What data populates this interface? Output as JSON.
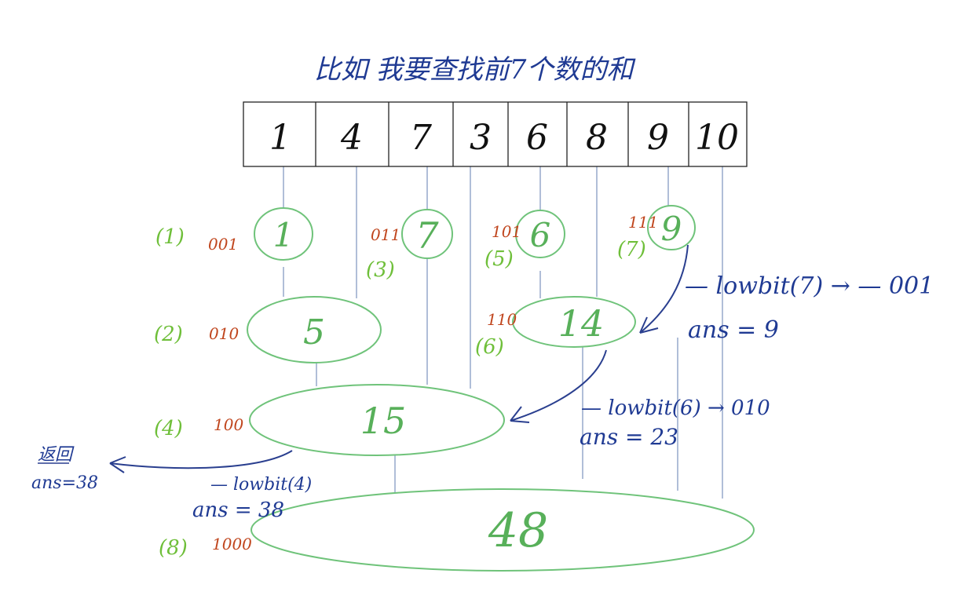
{
  "title": "比如 我要查找前7个数的和",
  "array": [
    "1",
    "4",
    "7",
    "3",
    "6",
    "8",
    "9",
    "10"
  ],
  "nodes": [
    {
      "value": "1",
      "index": "(1)",
      "binary": "001"
    },
    {
      "value": "5",
      "index": "(2)",
      "binary": "010"
    },
    {
      "value": "7",
      "index": "(3)",
      "binary": "011"
    },
    {
      "value": "15",
      "index": "(4)",
      "binary": "100"
    },
    {
      "value": "6",
      "index": "(5)",
      "binary": "101"
    },
    {
      "value": "14",
      "index": "(6)",
      "binary": "110"
    },
    {
      "value": "9",
      "index": "(7)",
      "binary": "111"
    },
    {
      "value": "48",
      "index": "(8)",
      "binary": "1000"
    }
  ],
  "annotations": {
    "step1_op": "— lowbit(7) → — 001",
    "step1_ans": "ans = 9",
    "step2_op": "— lowbit(6) → 010",
    "step2_ans": "ans = 23",
    "step3_op": "— lowbit(4)",
    "step3_ans": "ans = 38",
    "return_label": "返回",
    "return_ans": "ans=38"
  },
  "colors": {
    "tree_nodes": "#58b05a",
    "indices": "#6fbf3a",
    "binary": "#c0461e",
    "annotation_ink": "#1f3a93",
    "guide_lines": "#8ea2c8"
  }
}
